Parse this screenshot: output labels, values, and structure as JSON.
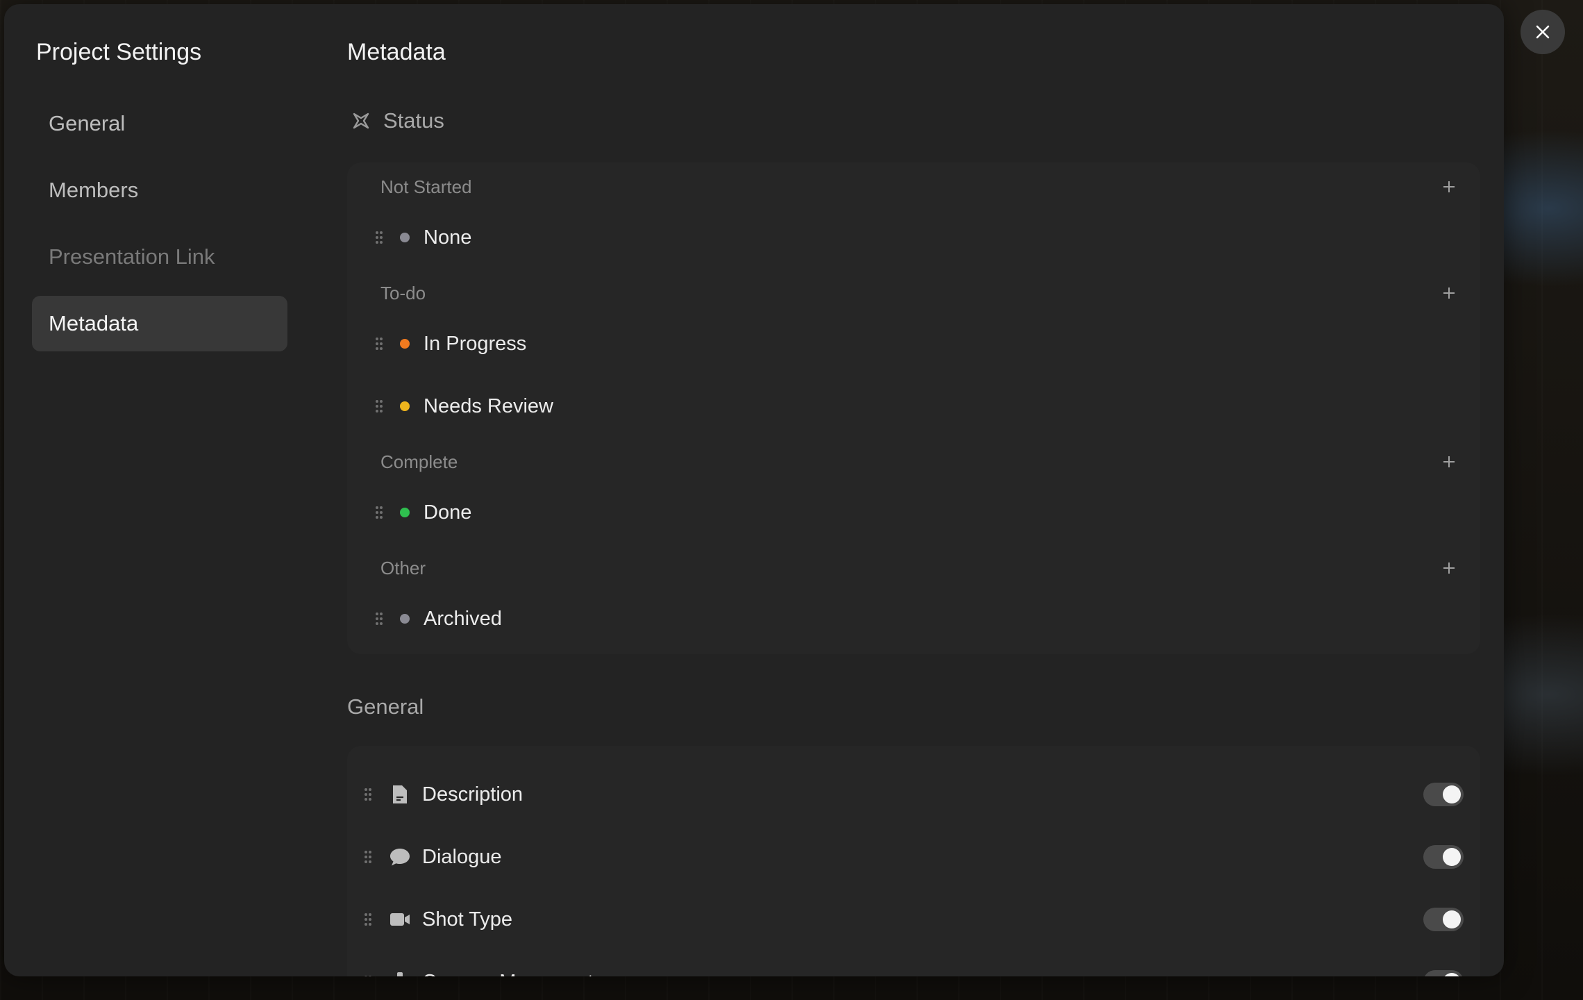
{
  "sidebar": {
    "title": "Project Settings",
    "items": [
      {
        "label": "General"
      },
      {
        "label": "Members"
      },
      {
        "label": "Presentation Link"
      },
      {
        "label": "Metadata"
      }
    ]
  },
  "main": {
    "title": "Metadata",
    "status_section": {
      "label": "Status",
      "groups": [
        {
          "label": "Not Started",
          "statuses": [
            {
              "label": "None",
              "color": "#8a8a93"
            }
          ]
        },
        {
          "label": "To-do",
          "statuses": [
            {
              "label": "In Progress",
              "color": "#f07a1f"
            },
            {
              "label": "Needs Review",
              "color": "#f0b51d"
            }
          ]
        },
        {
          "label": "Complete",
          "statuses": [
            {
              "label": "Done",
              "color": "#2fbf4f"
            }
          ]
        },
        {
          "label": "Other",
          "statuses": [
            {
              "label": "Archived",
              "color": "#8a8a93"
            }
          ]
        }
      ]
    },
    "general_section": {
      "label": "General",
      "fields": [
        {
          "label": "Description",
          "icon": "document-icon",
          "enabled": true
        },
        {
          "label": "Dialogue",
          "icon": "speech-bubble-icon",
          "enabled": true
        },
        {
          "label": "Shot Type",
          "icon": "video-camera-icon",
          "enabled": true
        },
        {
          "label": "Camera Movement",
          "icon": "move-arrows-icon",
          "enabled": true
        }
      ]
    }
  },
  "colors": {
    "modal_bg": "#232323",
    "card_bg": "#262626",
    "active_nav_bg": "#383838"
  }
}
